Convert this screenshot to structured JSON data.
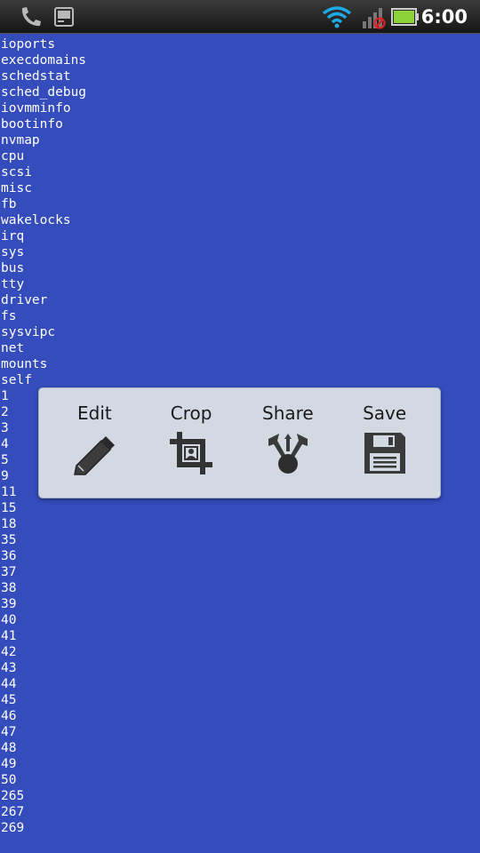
{
  "status_bar": {
    "time": "6:00",
    "icons": [
      "phone-icon",
      "terminal-icon",
      "wifi-icon",
      "signal-icon",
      "no-signal-icon",
      "battery-icon"
    ],
    "battery_color": "#8ed23a"
  },
  "screen": {
    "background": "#344cbc",
    "entries": [
      "ioports",
      "execdomains",
      "schedstat",
      "sched_debug",
      "iovmminfo",
      "bootinfo",
      "nvmap",
      "cpu",
      "scsi",
      "misc",
      "fb",
      "wakelocks",
      "irq",
      "sys",
      "bus",
      "tty",
      "driver",
      "fs",
      "sysvipc",
      "net",
      "mounts",
      "self",
      "1",
      "2",
      "3",
      "4",
      "5",
      "9",
      "11",
      "15",
      "18",
      "35",
      "36",
      "37",
      "38",
      "39",
      "40",
      "41",
      "42",
      "43",
      "44",
      "45",
      "46",
      "47",
      "48",
      "49",
      "50",
      "265",
      "267",
      "269"
    ]
  },
  "menu": {
    "items": [
      {
        "label": "Edit",
        "icon": "pencil-icon"
      },
      {
        "label": "Crop",
        "icon": "crop-icon"
      },
      {
        "label": "Share",
        "icon": "share-icon"
      },
      {
        "label": "Save",
        "icon": "floppy-disk-icon"
      }
    ]
  }
}
